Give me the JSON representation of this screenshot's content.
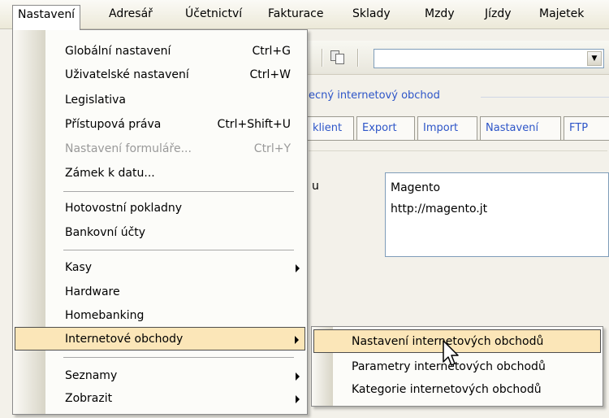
{
  "menubar": {
    "items": [
      "Nastavení",
      "Adresář",
      "Účetnictví",
      "Fakturace",
      "Sklady",
      "Mzdy",
      "Jízdy",
      "Majetek"
    ]
  },
  "background": {
    "section_title": "ecný internetový obchod",
    "tabs": [
      "klient",
      "Export",
      "Import",
      "Nastavení",
      "FTP"
    ],
    "field_label": "u",
    "text_lines": [
      "Magento",
      "http://magento.jt"
    ]
  },
  "menu": {
    "items": [
      {
        "label": "Globální nastavení",
        "shortcut": "Ctrl+G"
      },
      {
        "label": "Uživatelské nastavení",
        "shortcut": "Ctrl+W"
      },
      {
        "label": "Legislativa",
        "shortcut": ""
      },
      {
        "label": "Přístupová práva",
        "shortcut": "Ctrl+Shift+U"
      },
      {
        "label": "Nastavení formuláře...",
        "shortcut": "Ctrl+Y"
      },
      {
        "label": "Zámek k datu...",
        "shortcut": ""
      },
      {
        "label": "Hotovostní pokladny",
        "shortcut": ""
      },
      {
        "label": "Bankovní účty",
        "shortcut": ""
      },
      {
        "label": "Kasy",
        "shortcut": ""
      },
      {
        "label": "Hardware",
        "shortcut": ""
      },
      {
        "label": "Homebanking",
        "shortcut": ""
      },
      {
        "label": "Internetové obchody",
        "shortcut": ""
      },
      {
        "label": "Seznamy",
        "shortcut": ""
      },
      {
        "label": "Zobrazit",
        "shortcut": ""
      }
    ]
  },
  "submenu": {
    "items": [
      "Nastavení internetových obchodů",
      "Parametry internetových obchodů",
      "Kategorie internetových obchodů"
    ]
  },
  "colors": {
    "highlight": "#fbe6b8",
    "link_blue": "#2d55c8"
  }
}
